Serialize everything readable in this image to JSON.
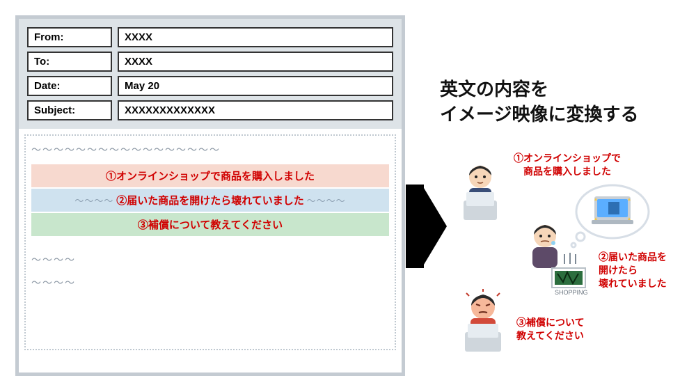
{
  "email": {
    "fields": [
      {
        "label": "From:",
        "value": "XXXX"
      },
      {
        "label": "To:",
        "value": "XXXX"
      },
      {
        "label": "Date:",
        "value": "May 20"
      },
      {
        "label": "Subject:",
        "value": "XXXXXXXXXXXXX"
      }
    ],
    "wave": "～～～～～～～～～～～～～～～～～",
    "wave_short": "～～～～",
    "lines": [
      {
        "text": "①オンラインショップで商品を購入しました",
        "color": "red"
      },
      {
        "text": "②届いた商品を開けたら壊れていました",
        "color": "blue"
      },
      {
        "text": "③補償について教えてください",
        "color": "green"
      }
    ]
  },
  "right": {
    "title_line1": "英文の内容を",
    "title_line2": "イメージ映像に変換する",
    "caption1_l1": "①オンラインショップで",
    "caption1_l2": "商品を購入しました",
    "caption2_l1": "②届いた商品を",
    "caption2_l2": "開けたら",
    "caption2_l3": "壊れていました",
    "caption3_l1": "③補償について",
    "caption3_l2": "教えてください"
  }
}
